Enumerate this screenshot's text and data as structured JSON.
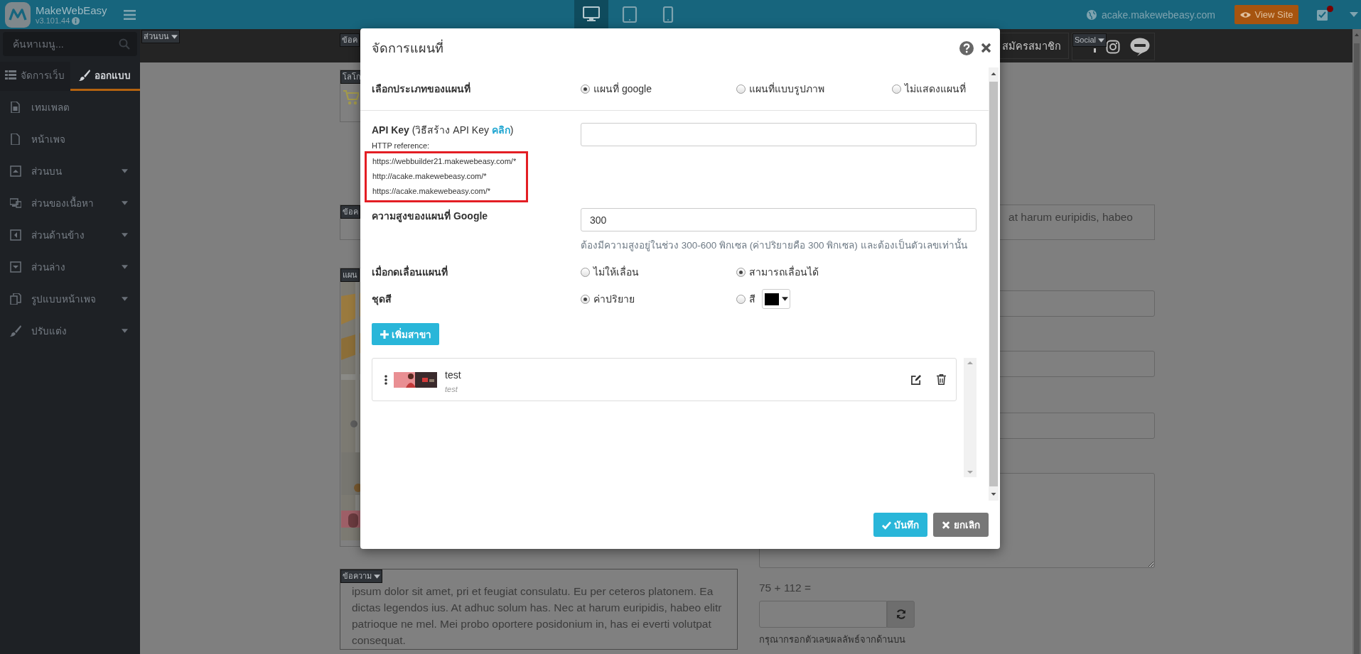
{
  "app_bar": {
    "brand": "MakeWebEasy",
    "version": "v3.101.44",
    "devices": [
      {
        "kind": "desktop",
        "selected": true
      },
      {
        "kind": "tablet",
        "selected": false
      },
      {
        "kind": "mobile",
        "selected": false
      }
    ],
    "site": "acake.makewebeasy.com",
    "view_site": "View Site",
    "has_notification": true
  },
  "sidebar": {
    "search_placeholder": "ค้นหาเมนู...",
    "tabs": [
      {
        "label": "จัดการเว็บ",
        "selected": false
      },
      {
        "label": "ออกแบบ",
        "selected": true
      }
    ],
    "items": [
      {
        "label": "เทมเพลต",
        "expandable": false
      },
      {
        "label": "หน้าเพจ",
        "expandable": false
      },
      {
        "label": "ส่วนบน",
        "expandable": true
      },
      {
        "label": "ส่วนของเนื้อหา",
        "expandable": true
      },
      {
        "label": "ส่วนด้านข้าง",
        "expandable": true
      },
      {
        "label": "ส่วนล่าง",
        "expandable": true
      },
      {
        "label": "รูปแบบหน้าเพจ",
        "expandable": true
      },
      {
        "label": "ปรับแต่ง",
        "expandable": true
      }
    ]
  },
  "canvas": {
    "top_tag": "ส่วนบน",
    "header_tag": "ข้อค",
    "signup": "สมัครสมาชิก",
    "social_tag": "Social",
    "logo_tag": "โลโก",
    "text_tag": "ข้อค",
    "text_visible": "at harum euripidis, habeo",
    "map_tag": "แผน",
    "bottom_text": {
      "tag": "ข้อความ",
      "text": "ipsum dolor sit amet, pri et feugiat consulatu. Eu per ceteros platonem. Ea dictas legendos ius. At adhuc solum has. Nec at harum euripidis, habeo elitr patrioque ne mel. Mei probo oportere posidonium in, has ei everti volutpat consequat."
    },
    "captcha": {
      "question": "75 + 112 =",
      "hint": "กรุณากรอกตัวเลขผลลัพธ์จากด้านบน"
    }
  },
  "modal": {
    "title": "จัดการแผนที่",
    "map_type": {
      "label": "เลือกประเภทของแผนที่",
      "options": [
        {
          "label": "แผนที่ google",
          "selected": true
        },
        {
          "label": "แผนที่แบบรูปภาพ",
          "selected": false
        },
        {
          "label": "ไม่แสดงแผนที่",
          "selected": false
        }
      ]
    },
    "api_key": {
      "label": "**API Key** (วิธีสร้าง API Key ",
      "link": "คลิก",
      "label_end": ")",
      "reference_title": "HTTP reference:",
      "references": [
        "https://webbuilder21.makewebeasy.com/*",
        "http://acake.makewebeasy.com/*",
        "https://acake.makewebeasy.com/*"
      ],
      "highlighted": true
    },
    "height": {
      "label": "ความสูงของแผนที่ Google",
      "value": "300",
      "help": "ต้องมีความสูงอยู่ในช่วง 300-600 พิกเซล (ค่าปริยายคือ 300 พิกเซล) และต้องเป็นตัวเลขเท่านั้น"
    },
    "dragging": {
      "label": "เมื่อกดเลื่อนแผนที่",
      "options": [
        {
          "label": "ไม่ให้เลื่อน",
          "selected": false
        },
        {
          "label": "สามารถเลื่อนได้",
          "selected": true
        }
      ]
    },
    "color_scheme": {
      "label": "ชุดสี",
      "options": [
        {
          "label": "ค่าปริยาย",
          "selected": true
        },
        {
          "label": "สี",
          "selected": false,
          "color": "#000000"
        }
      ]
    },
    "add_branch": "เพิ่มสาขา",
    "branches": [
      {
        "name": "test",
        "subtitle": "test"
      }
    ],
    "buttons": [
      {
        "kind": "save",
        "label": "บันทึก"
      },
      {
        "kind": "cancel",
        "label": "ยกเลิก"
      }
    ]
  }
}
